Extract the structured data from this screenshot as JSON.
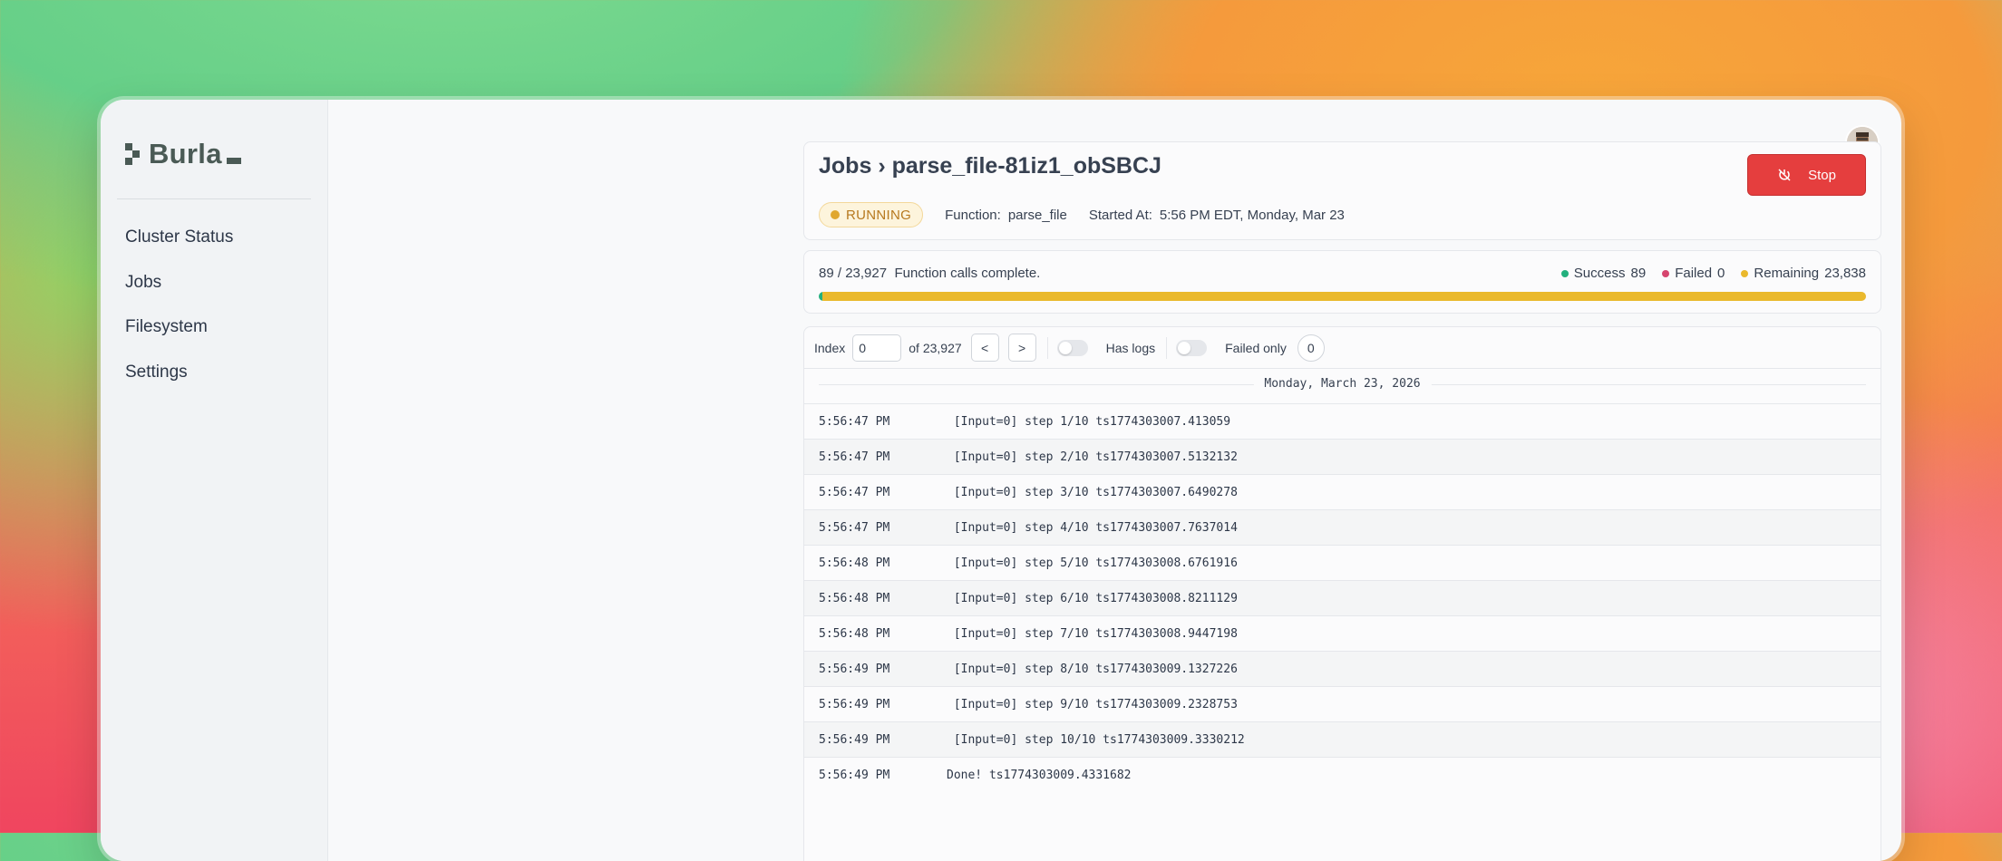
{
  "app": {
    "name": "Burla"
  },
  "sidebar": {
    "items": [
      {
        "label": "Cluster Status"
      },
      {
        "label": "Jobs"
      },
      {
        "label": "Filesystem"
      },
      {
        "label": "Settings"
      }
    ]
  },
  "header": {
    "breadcrumb_root": "Jobs",
    "breadcrumb_sep": "›",
    "job_id": "parse_file-81iz1_obSBCJ",
    "status": "RUNNING",
    "function_label": "Function:",
    "function_name": "parse_file",
    "started_label": "Started At:",
    "started_value": "5:56 PM EDT, Monday, Mar 23",
    "stop_label": "Stop"
  },
  "progress": {
    "done": "89",
    "slash": "/",
    "total": "23,927",
    "summary": "Function calls complete.",
    "success_label": "Success",
    "success_value": "89",
    "failed_label": "Failed",
    "failed_value": "0",
    "remaining_label": "Remaining",
    "remaining_value": "23,838",
    "success_fraction": 0.0037,
    "failed_fraction": 0,
    "remaining_fraction": 0.9963
  },
  "colors": {
    "success": "#22b07d",
    "failed": "#d6456e",
    "remaining": "#eab92d",
    "stop_button": "#e53e3e"
  },
  "logs": {
    "index_label": "Index",
    "index_value": "0",
    "of_label": "of 23,927",
    "prev_label": "<",
    "next_label": ">",
    "has_logs_label": "Has logs",
    "failed_only_label": "Failed only",
    "failed_count": "0",
    "date": "Monday, March 23, 2026",
    "rows": [
      {
        "time": "5:56:47 PM",
        "message": " [Input=0] step 1/10 ts1774303007.413059"
      },
      {
        "time": "5:56:47 PM",
        "message": " [Input=0] step 2/10 ts1774303007.5132132"
      },
      {
        "time": "5:56:47 PM",
        "message": " [Input=0] step 3/10 ts1774303007.6490278"
      },
      {
        "time": "5:56:47 PM",
        "message": " [Input=0] step 4/10 ts1774303007.7637014"
      },
      {
        "time": "5:56:48 PM",
        "message": " [Input=0] step 5/10 ts1774303008.6761916"
      },
      {
        "time": "5:56:48 PM",
        "message": " [Input=0] step 6/10 ts1774303008.8211129"
      },
      {
        "time": "5:56:48 PM",
        "message": " [Input=0] step 7/10 ts1774303008.9447198"
      },
      {
        "time": "5:56:49 PM",
        "message": " [Input=0] step 8/10 ts1774303009.1327226"
      },
      {
        "time": "5:56:49 PM",
        "message": " [Input=0] step 9/10 ts1774303009.2328753"
      },
      {
        "time": "5:56:49 PM",
        "message": " [Input=0] step 10/10 ts1774303009.3330212"
      },
      {
        "time": "5:56:49 PM",
        "message": "Done! ts1774303009.4331682"
      }
    ]
  }
}
